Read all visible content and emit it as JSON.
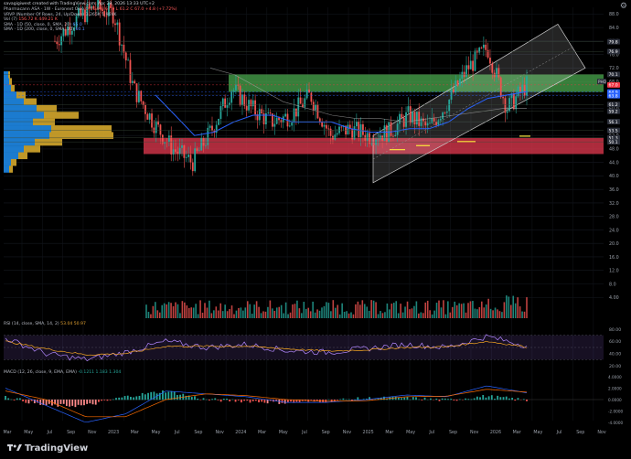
{
  "header": {
    "created_line": "savagigiwest created with TradingView.com, Apr 29, 2026 13:33 UTC+2",
    "symbol_line": "Pharmacann ASA · 1W · Euronext Oslo",
    "symbol_values": "O 61.9 H 67.0 L 61.2 C 67.0 +4.8 (+7.72%)",
    "vrvp_line": "VRVP (Number Of Rows, 24, Up/Down)",
    "vrvp_values": "3.265K 1.964K",
    "vol_line": "Vol (7)",
    "vol_values": "156.72 K 449.21 K",
    "sma50_line": "SMA · 1D (50, close, 0, SMA, 20)",
    "sma50_value": "65.0",
    "sma200_line": "SMA · 1D (200, close, 0, SMA, 20)",
    "sma200_value": "60.1"
  },
  "price_axis": {
    "ticks": [
      "88.0",
      "84.0",
      "80.0",
      "76.0",
      "72.0",
      "68.0",
      "64.0",
      "60.0",
      "56.0",
      "52.0",
      "48.0",
      "44.0",
      "40.0",
      "36.0",
      "32.0",
      "28.0",
      "24.0",
      "20.0",
      "16.0",
      "12.0",
      "8.0",
      "4.00"
    ],
    "badges": [
      {
        "text": "79.8",
        "color": "#2a2e39"
      },
      {
        "text": "76.9",
        "color": "#2a2e39"
      },
      {
        "text": "70.1",
        "color": "#2a2e39"
      },
      {
        "text": "67.0",
        "color": "#f23645"
      },
      {
        "text": "64.9",
        "color": "#2962ff"
      },
      {
        "text": "63.8",
        "color": "#2962ff"
      },
      {
        "text": "61.2",
        "color": "#2a2e39"
      },
      {
        "text": "59.2",
        "color": "#2a2e39"
      },
      {
        "text": "56.1",
        "color": "#2a2e39"
      },
      {
        "text": "53.5",
        "color": "#2a2e39"
      },
      {
        "text": "51.3",
        "color": "#2a2e39"
      },
      {
        "text": "50.1",
        "color": "#2a2e39"
      }
    ],
    "ticker_tag": "PHO"
  },
  "rsi": {
    "label": "RSI (14, close, SMA, 14, 2)",
    "values_text": "53.04 50.97",
    "ticks": [
      "80.00",
      "60.00",
      "40.00",
      "20.00"
    ]
  },
  "macd": {
    "label": "MACD (12, 26, close, 9, EMA, EMA)",
    "values_text": "-0.1211 1.183 1.304",
    "ticks": [
      "4.0000",
      "2.0000",
      "0.0000",
      "-2.0000",
      "-4.0000"
    ]
  },
  "time_axis": [
    "Mar",
    "May",
    "Jul",
    "Sep",
    "Nov",
    "2023",
    "Mar",
    "May",
    "Jul",
    "Sep",
    "Nov",
    "2024",
    "Mar",
    "May",
    "Jul",
    "Sep",
    "Nov",
    "2025",
    "Mar",
    "May",
    "Jul",
    "Sep",
    "Nov",
    "2026",
    "Mar",
    "May",
    "Jul",
    "Sep",
    "Nov"
  ],
  "brand": "TradingView",
  "colors": {
    "up": "#26a69a",
    "down": "#ef5350",
    "sma50": "#2962ff",
    "sma200": "#d4a017",
    "resistance_zone": "#4caf50",
    "support_zone": "#e53950",
    "vp_up": "#1e88e5",
    "vp_down": "#d4a72c",
    "rsi_band": "#7e57c2",
    "channel": "#ffffff"
  },
  "chart_data": [
    {
      "type": "line",
      "title": "Pharmacann ASA · 1W · Euronext Oslo (candlestick)",
      "x": [
        "2022-Mar",
        "2022-Jul",
        "2022-Nov",
        "2023-Jan",
        "2023-Mar",
        "2023-May",
        "2023-Jul",
        "2023-Sep",
        "2023-Nov",
        "2024-Jan",
        "2024-Mar",
        "2024-May",
        "2024-Jul",
        "2024-Sep",
        "2024-Nov",
        "2025-Jan",
        "2025-Mar",
        "2025-May",
        "2025-Jul",
        "2025-Sep",
        "2025-Nov",
        "2026-Jan",
        "2026-Feb",
        "2026-Mar",
        "2026-Apr"
      ],
      "series": [
        {
          "name": "Close",
          "values": [
            80.0,
            86.0,
            90.0,
            88.0,
            66.0,
            56.0,
            48.0,
            44.0,
            54.0,
            66.0,
            60.0,
            56.0,
            58.0,
            64.0,
            52.0,
            54.0,
            52.0,
            53.0,
            58.0,
            54.0,
            62.0,
            72.0,
            78.0,
            60.0,
            67.0
          ]
        },
        {
          "name": "SMA 50",
          "values": [
            null,
            null,
            null,
            null,
            null,
            64.0,
            58.0,
            52.0,
            53.0,
            56.0,
            58.0,
            58.0,
            56.0,
            56.0,
            56.0,
            54.0,
            53.0,
            53.0,
            54.0,
            54.0,
            56.0,
            60.0,
            63.0,
            64.0,
            65.0
          ]
        },
        {
          "name": "SMA 200",
          "values": [
            null,
            null,
            null,
            null,
            null,
            null,
            null,
            null,
            null,
            null,
            null,
            72.0,
            70.0,
            66.0,
            62.0,
            60.0,
            58.0,
            57.0,
            57.0,
            56.0,
            57.0,
            58.0,
            59.0,
            60.0,
            60.1
          ]
        }
      ],
      "zones": [
        {
          "name": "resistance",
          "from": 64.9,
          "to": 70.1
        },
        {
          "name": "support",
          "from": 46.5,
          "to": 51.3
        }
      ],
      "ylim": [
        0,
        90
      ],
      "log_scale": false,
      "grid": true
    },
    {
      "type": "bar",
      "title": "Vol (7)",
      "categories": [
        "2022-Mar",
        "2022-Jul",
        "2022-Nov",
        "2023-Jan",
        "2023-Mar",
        "2023-May",
        "2023-Jul",
        "2023-Sep",
        "2023-Nov",
        "2024-Jan",
        "2024-Mar",
        "2024-May",
        "2024-Jul",
        "2024-Sep",
        "2024-Nov",
        "2025-Jan",
        "2025-Mar",
        "2025-May",
        "2025-Jul",
        "2025-Sep",
        "2025-Nov",
        "2026-Jan",
        "2026-Feb",
        "2026-Mar",
        "2026-Apr"
      ],
      "values": [
        0,
        0,
        0,
        0,
        0,
        3.0,
        3.5,
        4.0,
        4.5,
        7.0,
        5.0,
        3.5,
        4.0,
        6.0,
        5.0,
        4.0,
        3.5,
        5.0,
        4.0,
        4.5,
        5.5,
        8.5,
        7.0,
        6.0,
        8.0
      ],
      "ylabel": "K"
    },
    {
      "type": "line",
      "title": "RSI (14, close, SMA, 14, 2)",
      "x": [
        "2023-Jan",
        "2023-Apr",
        "2023-Jul",
        "2023-Oct",
        "2024-Jan",
        "2024-Apr",
        "2024-Jul",
        "2024-Oct",
        "2025-Jan",
        "2025-Apr",
        "2025-Jul",
        "2025-Oct",
        "2026-Jan",
        "2026-Apr"
      ],
      "series": [
        {
          "name": "RSI",
          "values": [
            65,
            40,
            30,
            42,
            60,
            50,
            55,
            45,
            42,
            48,
            55,
            50,
            68,
            53.04
          ]
        },
        {
          "name": "RSI SMA",
          "values": [
            60,
            48,
            38,
            40,
            52,
            52,
            52,
            48,
            44,
            46,
            50,
            51,
            60,
            50.97
          ]
        }
      ],
      "ylim": [
        20,
        80
      ]
    },
    {
      "type": "bar",
      "title": "MACD (12, 26, close, 9, EMA, EMA)",
      "categories": [
        "2023-Jan",
        "2023-Apr",
        "2023-Jul",
        "2023-Oct",
        "2024-Jan",
        "2024-Apr",
        "2024-Jul",
        "2024-Oct",
        "2025-Jan",
        "2025-Apr",
        "2025-Jul",
        "2025-Oct",
        "2026-Jan",
        "2026-Apr"
      ],
      "series": [
        {
          "name": "MACD",
          "values": [
            2.0,
            -1.0,
            -4.0,
            -2.5,
            1.5,
            1.0,
            0.5,
            -0.5,
            -0.5,
            0.0,
            0.8,
            0.5,
            2.4,
            1.183
          ]
        },
        {
          "name": "Signal",
          "values": [
            1.5,
            0.0,
            -3.0,
            -3.0,
            0.0,
            1.0,
            0.7,
            0.0,
            -0.3,
            -0.2,
            0.5,
            0.6,
            1.8,
            1.304
          ]
        },
        {
          "name": "Histogram",
          "values": [
            0.5,
            -1.0,
            -1.0,
            0.5,
            1.5,
            0.0,
            -0.2,
            -0.5,
            -0.2,
            0.2,
            0.3,
            -0.1,
            0.6,
            -0.1211
          ]
        }
      ],
      "ylim": [
        -4,
        4
      ]
    }
  ]
}
